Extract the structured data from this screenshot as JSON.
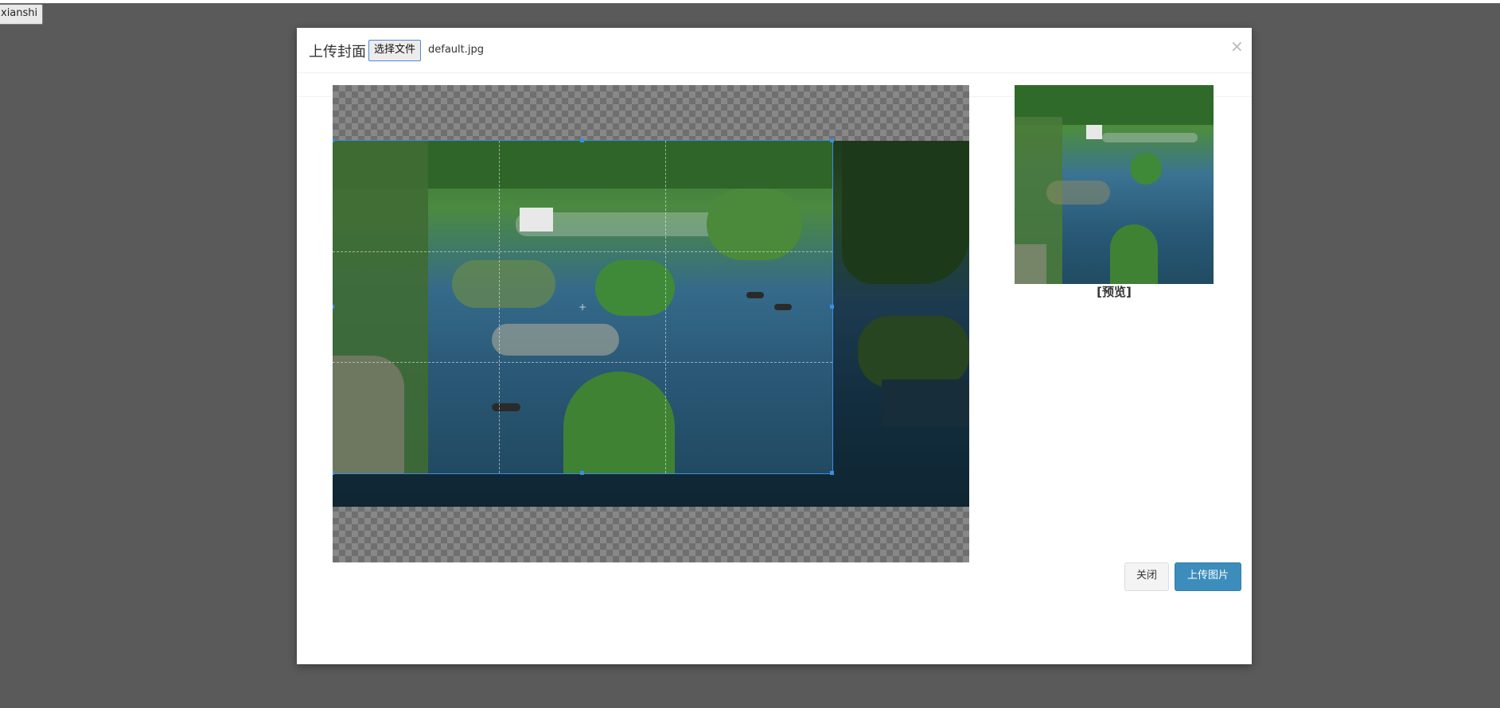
{
  "page": {
    "trigger_button_label": "xianshi"
  },
  "modal": {
    "title": "上传封面",
    "choose_file_label": "选择文件",
    "file_name": "default.jpg",
    "close_symbol": "×"
  },
  "cropper": {
    "center_symbol": "+"
  },
  "preview": {
    "caption": "[预览]"
  },
  "footer": {
    "close_label": "关闭",
    "upload_label": "上传图片"
  },
  "colors": {
    "primary": "#3c8dbc",
    "crop_outline": "#3b8ee0",
    "overlay": "#5a5a5a"
  },
  "icons": {
    "close": "close-icon",
    "crosshair": "crosshair-icon"
  }
}
